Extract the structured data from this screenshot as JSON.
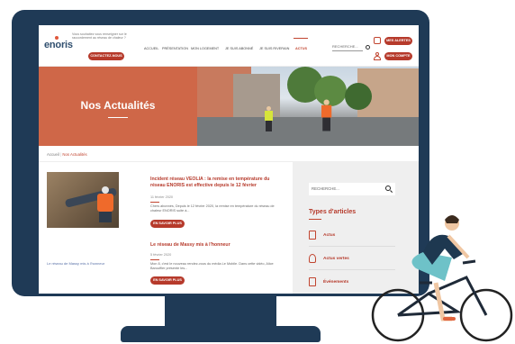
{
  "site": {
    "logo": "enoris",
    "tagline": "Vous souhaitez vous renseigner sur le raccordement au réseau de chaleur ?",
    "contact_label": "CONTACTEZ-NOUS",
    "nav": [
      "ACCUEIL",
      "PRÉSENTATION",
      "MON LOGEMENT",
      "JE SUIS ABONNÉ",
      "JE SUIS RIVERAIN",
      "ACTUS"
    ],
    "search_placeholder": "RECHERCHE...",
    "alerts_label": "MES ALERTES",
    "account_label": "MON COMPTE"
  },
  "hero": {
    "title": "Nos Actualités"
  },
  "breadcrumb": {
    "home": "Accueil",
    "current": "Nos Actualités"
  },
  "articles": [
    {
      "title": "Incident réseau VEOLIA : la remise en température du réseau ENORIS est effective depuis le 12 février",
      "date": "11 février 2020",
      "excerpt": "Chers abonnés, Depuis le 12 février 2020, la remise en température du réseau de chaleur ENORIS suite à...",
      "button": "EN SAVOIR PLUS"
    },
    {
      "title": "Le réseau de Massy mis à l'honneur",
      "date": "5 février 2020",
      "excerpt": "Mon 8, c'est le nouveau rendez-vous du média Le Mobile. Dans cette vidéo, Alice Barouffier présente les...",
      "button": "EN SAVOIR PLUS",
      "image_alt": "Le réseau de Massy mis à l'honneur"
    }
  ],
  "sidebar": {
    "search_placeholder": "RECHERCHE...",
    "heading": "Types d'articles",
    "items": [
      {
        "label": "Actus",
        "icon": "document-icon"
      },
      {
        "label": "Actus vertes",
        "icon": "leaf-hand-icon"
      },
      {
        "label": "Événements",
        "icon": "calendar-icon"
      }
    ]
  },
  "colors": {
    "brand_red": "#b63a2b",
    "hero_orange": "#cf6748",
    "monitor_navy": "#1f3a56",
    "sidebar_bg": "#efefef"
  }
}
